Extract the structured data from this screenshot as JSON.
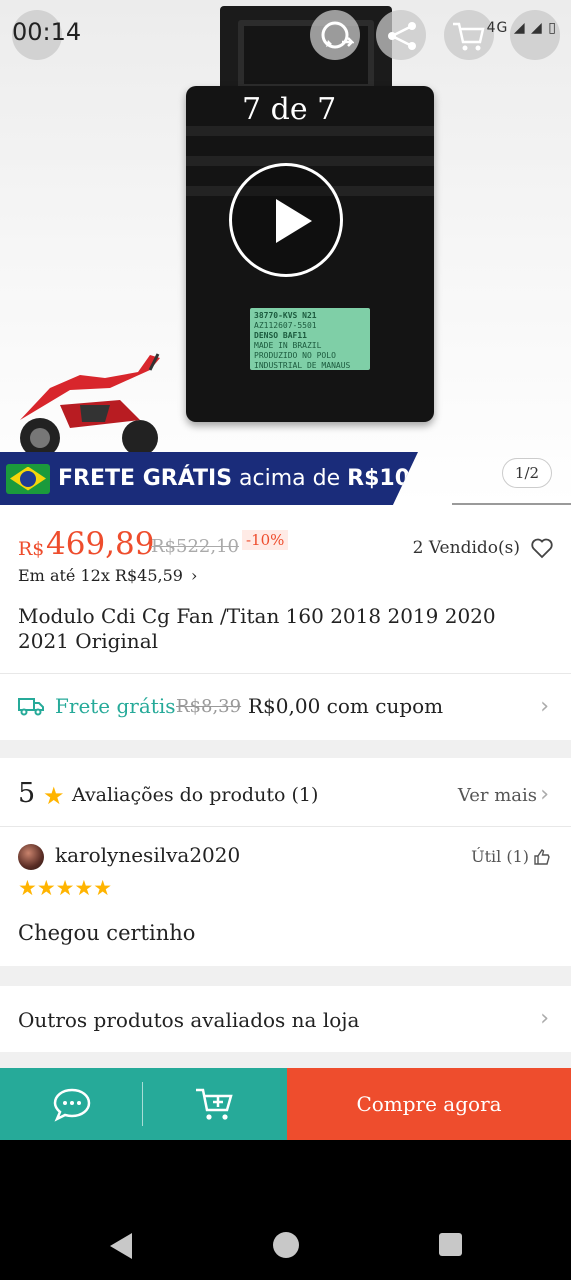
{
  "status": {
    "time": "00:14",
    "network": "4G"
  },
  "gallery": {
    "counter": "7 de 7",
    "pager": "1/2",
    "label_lines": [
      "38770-KVS N21",
      "AZ112607-5501",
      "DENSO BAF11",
      "MADE IN BRAZIL",
      "PRODUZIDO NO POLO",
      "INDUSTRIAL DE MANAUS"
    ]
  },
  "banner": {
    "prefix": "FRETE GRÁTIS",
    "middle": " acima de ",
    "amount": "R$10"
  },
  "product": {
    "currency": "R$",
    "price": "469,89",
    "old_price": "R$522,10",
    "discount": "-10%",
    "sold": "2 Vendido(s)",
    "installments": "Em até 12x R$45,59",
    "title": "Modulo Cdi Cg Fan /Titan 160 2018 2019 2020 2021 Original"
  },
  "shipping": {
    "free_label": "Frete grátis",
    "old_price": "R$8,39",
    "new_price": "R$0,00 com cupom"
  },
  "ratings": {
    "score": "5",
    "label": "Avaliações do produto (1)",
    "see_more": "Ver mais"
  },
  "review": {
    "user": "karolynesilva2020",
    "useful": "Útil (1)",
    "stars": "★★★★★",
    "comment": "Chegou certinho"
  },
  "others": {
    "label": "Outros produtos avaliados na loja"
  },
  "actions": {
    "buy": "Compre agora"
  },
  "colors": {
    "accent": "#ee4d2d",
    "teal": "#26aa99",
    "banner_blue": "#1a2c7a",
    "star": "#ffb400"
  }
}
